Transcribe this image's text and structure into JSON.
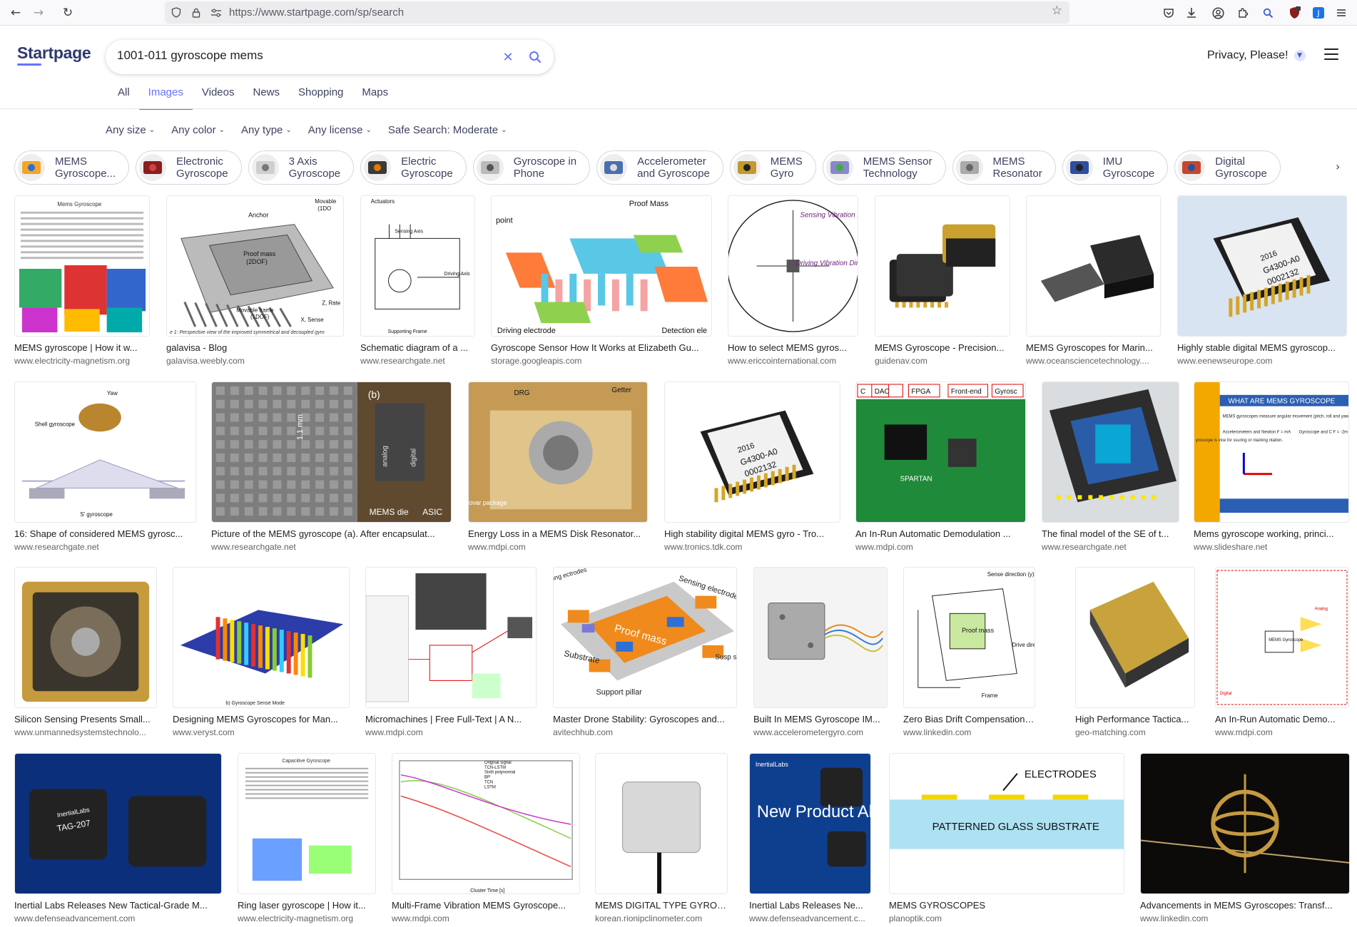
{
  "browser": {
    "url": "https://www.startpage.com/sp/search",
    "back_icon": "arrow-left-icon",
    "forward_icon": "arrow-right-icon",
    "reload_icon": "reload-icon"
  },
  "header": {
    "logo": "Startpage",
    "query": "1001-011 gyroscope mems",
    "privacy_label": "Privacy, Please!"
  },
  "tabs": [
    "All",
    "Images",
    "Videos",
    "News",
    "Shopping",
    "Maps"
  ],
  "active_tab": "Images",
  "filters": [
    "Any size",
    "Any color",
    "Any type",
    "Any license",
    "Safe Search: Moderate"
  ],
  "chips": [
    {
      "l1": "MEMS",
      "l2": "Gyroscope..."
    },
    {
      "l1": "Electronic",
      "l2": "Gyroscope"
    },
    {
      "l1": "3 Axis",
      "l2": "Gyroscope"
    },
    {
      "l1": "Electric",
      "l2": "Gyroscope"
    },
    {
      "l1": "Gyroscope in",
      "l2": "Phone"
    },
    {
      "l1": "Accelerometer",
      "l2": "and Gyroscope"
    },
    {
      "l1": "MEMS",
      "l2": "Gyro"
    },
    {
      "l1": "MEMS Sensor",
      "l2": "Technology"
    },
    {
      "l1": "MEMS",
      "l2": "Resonator"
    },
    {
      "l1": "IMU",
      "l2": "Gyroscope"
    },
    {
      "l1": "Digital",
      "l2": "Gyroscope"
    }
  ],
  "colors": {
    "accent": "#6573ff",
    "logo": "#2e3a6e",
    "domain": "#5f6368"
  },
  "results": [
    [
      {
        "title": "MEMS gyroscope | How it w...",
        "domain": "www.electricity-magnetism.org"
      },
      {
        "title": "galavisa - Blog",
        "domain": "galavisa.weebly.com"
      },
      {
        "title": "Schematic diagram of a ...",
        "domain": "www.researchgate.net"
      },
      {
        "title": "Gyroscope Sensor How It Works at Elizabeth Gu...",
        "domain": "storage.googleapis.com"
      },
      {
        "title": "How to select MEMS gyros...",
        "domain": "www.ericcointernational.com"
      },
      {
        "title": "MEMS Gyroscope - Precision...",
        "domain": "guidenav.com"
      },
      {
        "title": "MEMS Gyroscopes for Marin...",
        "domain": "www.oceansciencetechnology...."
      },
      {
        "title": "Highly stable digital MEMS gyroscop...",
        "domain": "www.eenewseurope.com"
      }
    ],
    [
      {
        "title": "16: Shape of considered MEMS gyrosc...",
        "domain": "www.researchgate.net"
      },
      {
        "title": "Picture of the MEMS gyroscope (a). After encapsulat...",
        "domain": "www.researchgate.net"
      },
      {
        "title": "Energy Loss in a MEMS Disk Resonator...",
        "domain": "www.mdpi.com"
      },
      {
        "title": "High stability digital MEMS gyro - Tro...",
        "domain": "www.tronics.tdk.com"
      },
      {
        "title": "An In-Run Automatic Demodulation ...",
        "domain": "www.mdpi.com"
      },
      {
        "title": "The final model of the SE of t...",
        "domain": "www.researchgate.net"
      },
      {
        "title": "Mems gyroscope working, princi...",
        "domain": "www.slideshare.net"
      }
    ],
    [
      {
        "title": "Silicon Sensing Presents Small...",
        "domain": "www.unmannedsystemstechnolo..."
      },
      {
        "title": "Designing MEMS Gyroscopes for Man...",
        "domain": "www.veryst.com"
      },
      {
        "title": "Micromachines | Free Full-Text | A N...",
        "domain": "www.mdpi.com"
      },
      {
        "title": "Master Drone Stability: Gyroscopes and...",
        "domain": "avitechhub.com"
      },
      {
        "title": "Built In MEMS Gyroscope IM...",
        "domain": "www.accelerometergyro.com"
      },
      {
        "title": "Zero Bias Drift Compensation Me...",
        "domain": "www.linkedin.com"
      },
      {
        "title": "High Performance Tactica...",
        "domain": "geo-matching.com"
      },
      {
        "title": "An In-Run Automatic Demo...",
        "domain": "www.mdpi.com"
      }
    ],
    [
      {
        "title": "Inertial Labs Releases New Tactical-Grade M...",
        "domain": "www.defenseadvancement.com"
      },
      {
        "title": "Ring laser gyroscope | How it...",
        "domain": "www.electricity-magnetism.org"
      },
      {
        "title": "Multi-Frame Vibration MEMS Gyroscope...",
        "domain": "www.mdpi.com"
      },
      {
        "title": "MEMS DIGITAL TYPE GYROS...",
        "domain": "korean.rionipclinometer.com"
      },
      {
        "title": "Inertial Labs Releases Ne...",
        "domain": "www.defenseadvancement.c..."
      },
      {
        "title": "MEMS GYROSCOPES",
        "domain": "planoptik.com"
      },
      {
        "title": "Advancements in MEMS Gyroscopes: Transf...",
        "domain": "www.linkedin.com"
      }
    ]
  ],
  "image_text": {
    "r0c0_heading": "Mems Gyroscope",
    "r0c1_anchor": "Anchor",
    "r0c1_movable_top": "Movable",
    "r0c1_movable_top2": "(1DO",
    "r0c1_proof": "Proof mass",
    "r0c1_proof2": "(2DOF)",
    "r0c1_movable_bottom": "Movable frame",
    "r0c1_movable_bottom2": "(1DOF)",
    "r0c1_zrate": "Z, Rate",
    "r0c1_xsense": "X, Sense",
    "r0c1_caption": "e 1: Perspective view of the improved symmetrical and decoupled gyro",
    "r0c2_actuators": "Actuators",
    "r0c2_sensing_axis": "Sensing Axis",
    "r0c2_driving_axis": "Driving Axis",
    "r0c2_supporting": "Supporting Frame",
    "r0c3_proof": "Proof Mass",
    "r0c3_point": "point",
    "r0c3_driving": "Driving electrode",
    "r0c3_detection": "Detection ele",
    "r0c4_sensing": "Sensing Vibration Direction",
    "r0c4_driving": "Driving Vibration Direction",
    "r0c7_chip1": "2016",
    "r0c7_chip2": "G4300-A0",
    "r0c7_chip3": "0002132",
    "r1c0_yaw": "Yaw",
    "r1c0_shell": "Shell gyroscope",
    "r1c0_s": "S' gyroscope",
    "r1c1_b": "(b)",
    "r1c1_mm": "1.1 mm",
    "r1c1_analog": "analog",
    "r1c1_digital": "digital",
    "r1c1_memsdie": "MEMS die",
    "r1c1_asic": "ASIC",
    "r1c2_drg": "DRG",
    "r1c2_getter": "Getter",
    "r1c2_package": "ovar package",
    "r1c3_chip1": "2016",
    "r1c3_chip2": "G4300-A0",
    "r1c3_chip3": "0002132",
    "r1c4_labels": [
      "C",
      "DAC",
      "FPGA",
      "Front-end",
      "Gyrosc"
    ],
    "r1c4_spartan": "SPARTAN",
    "r1c6_head": "WHAT ARE MEMS GYROSCOPE",
    "r1c6_text": "MEMS gyroscopes measure angular movement (pitch, roll and yaw) using the Coriolis effect",
    "r1c6_acc": "Accelerometers and Newton F = mA",
    "r1c6_gyro": "Gyroscope and C F = -2m V x",
    "r1c6_bottom": "MEMS accelerometers and gyroscopes can be comb into an inertial measurement unit (IMU)",
    "r1c6_side": "yroscope is vice for ssuring or ntaining ntation.",
    "r2c1_caption": "b)  Gyroscope Sense Mode",
    "r2c3_proof": "Proof mass",
    "r2c3_substrate": "Substrate",
    "r2c3_sensing": "Sensing electrodes",
    "r2c3_support": "Support pillar",
    "r2c3_ing": "ing ectrodes",
    "r2c3_susp": "Susp sys",
    "r2c5_sense": "Sense direction (y)",
    "r2c5_proof": "Proof mass",
    "r2c5_drive": "Drive directi (x)",
    "r2c5_frame": "Frame",
    "r2c7_mems": "MEMS Gyroscope",
    "r2c7_digital": "Digital",
    "r2c7_analog": "Analog",
    "r3c0_brand": "InertialLabs",
    "r3c0_model": "TAG-207",
    "r3c1_heading": "Capacitive Gyroscope",
    "r3c2_legend": [
      "Original signal",
      "TCN-LSTM",
      "Sixth polynomial",
      "BP",
      "TCN",
      "LSTM"
    ],
    "r3c2_xlabel": "Cluster Time [s]",
    "r3c4_brand": "InertialLabs",
    "r3c4_promo": "New Product Alert!",
    "r3c5_electrodes": "ELECTRODES",
    "r3c5_substrate": "PATTERNED GLASS SUBSTRATE"
  }
}
